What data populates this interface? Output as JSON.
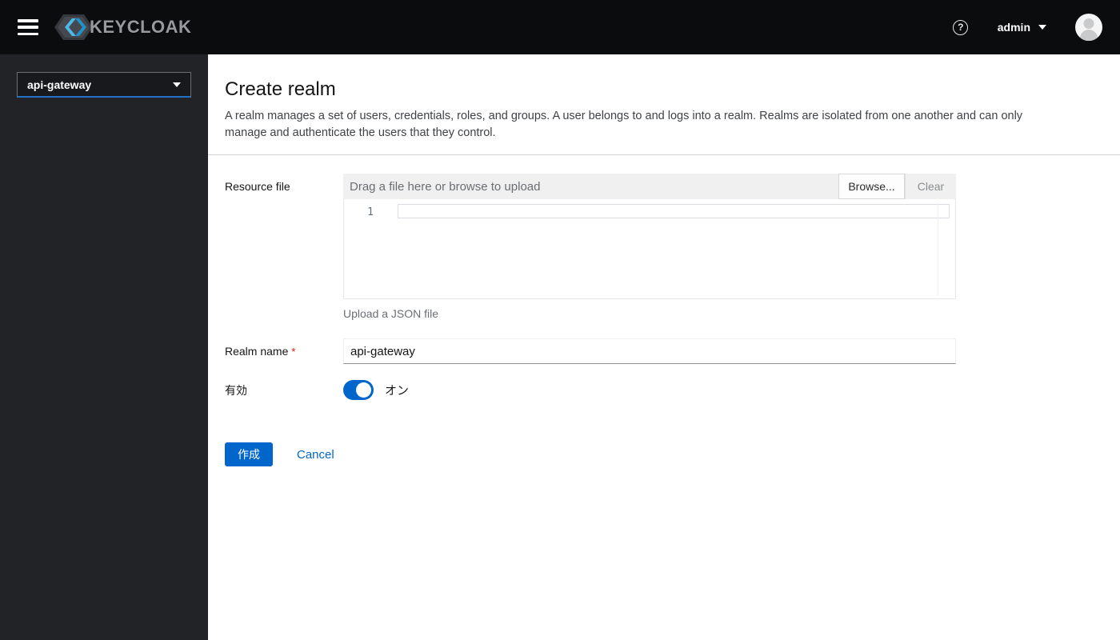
{
  "masthead": {
    "brand_text": "KEYCLOAK",
    "username": "admin",
    "help_icon_glyph": "?"
  },
  "sidebar": {
    "realm_selector": {
      "value": "api-gateway"
    }
  },
  "page_header": {
    "title": "Create realm",
    "description": "A realm manages a set of users, credentials, roles, and groups. A user belongs to and logs into a realm. Realms are isolated from one another and can only manage and authenticate the users that they control."
  },
  "form": {
    "resource_file": {
      "label": "Resource file",
      "upload_placeholder": "Drag a file here or browse to upload",
      "browse_button": "Browse...",
      "clear_button": "Clear",
      "editor_line_number": "1",
      "helper_text": "Upload a JSON file"
    },
    "realm_name": {
      "label": "Realm name",
      "required_indicator": "*",
      "value": "api-gateway"
    },
    "enabled_switch": {
      "label": "有効",
      "state_text": "オン",
      "is_on": true
    },
    "actions": {
      "create_button": "作成",
      "cancel_link": "Cancel"
    }
  },
  "icons": {
    "menu": "hamburger-icon",
    "help": "question-circle-icon",
    "user_caret": "chevron-down-icon",
    "realm_caret": "chevron-down-icon",
    "avatar": "user-avatar-icon",
    "logo": "keycloak-logo-icon"
  },
  "colors": {
    "accent_blue": "#0066cc",
    "masthead_bg": "#0b0c0e",
    "sidebar_bg": "#212327",
    "selector_underline_blue": "#2472c8",
    "required_red": "#c9190b",
    "upload_bar_gray": "#f0f0f0",
    "divider_gray": "#d2d2d2",
    "helper_gray": "#6a6e73"
  }
}
